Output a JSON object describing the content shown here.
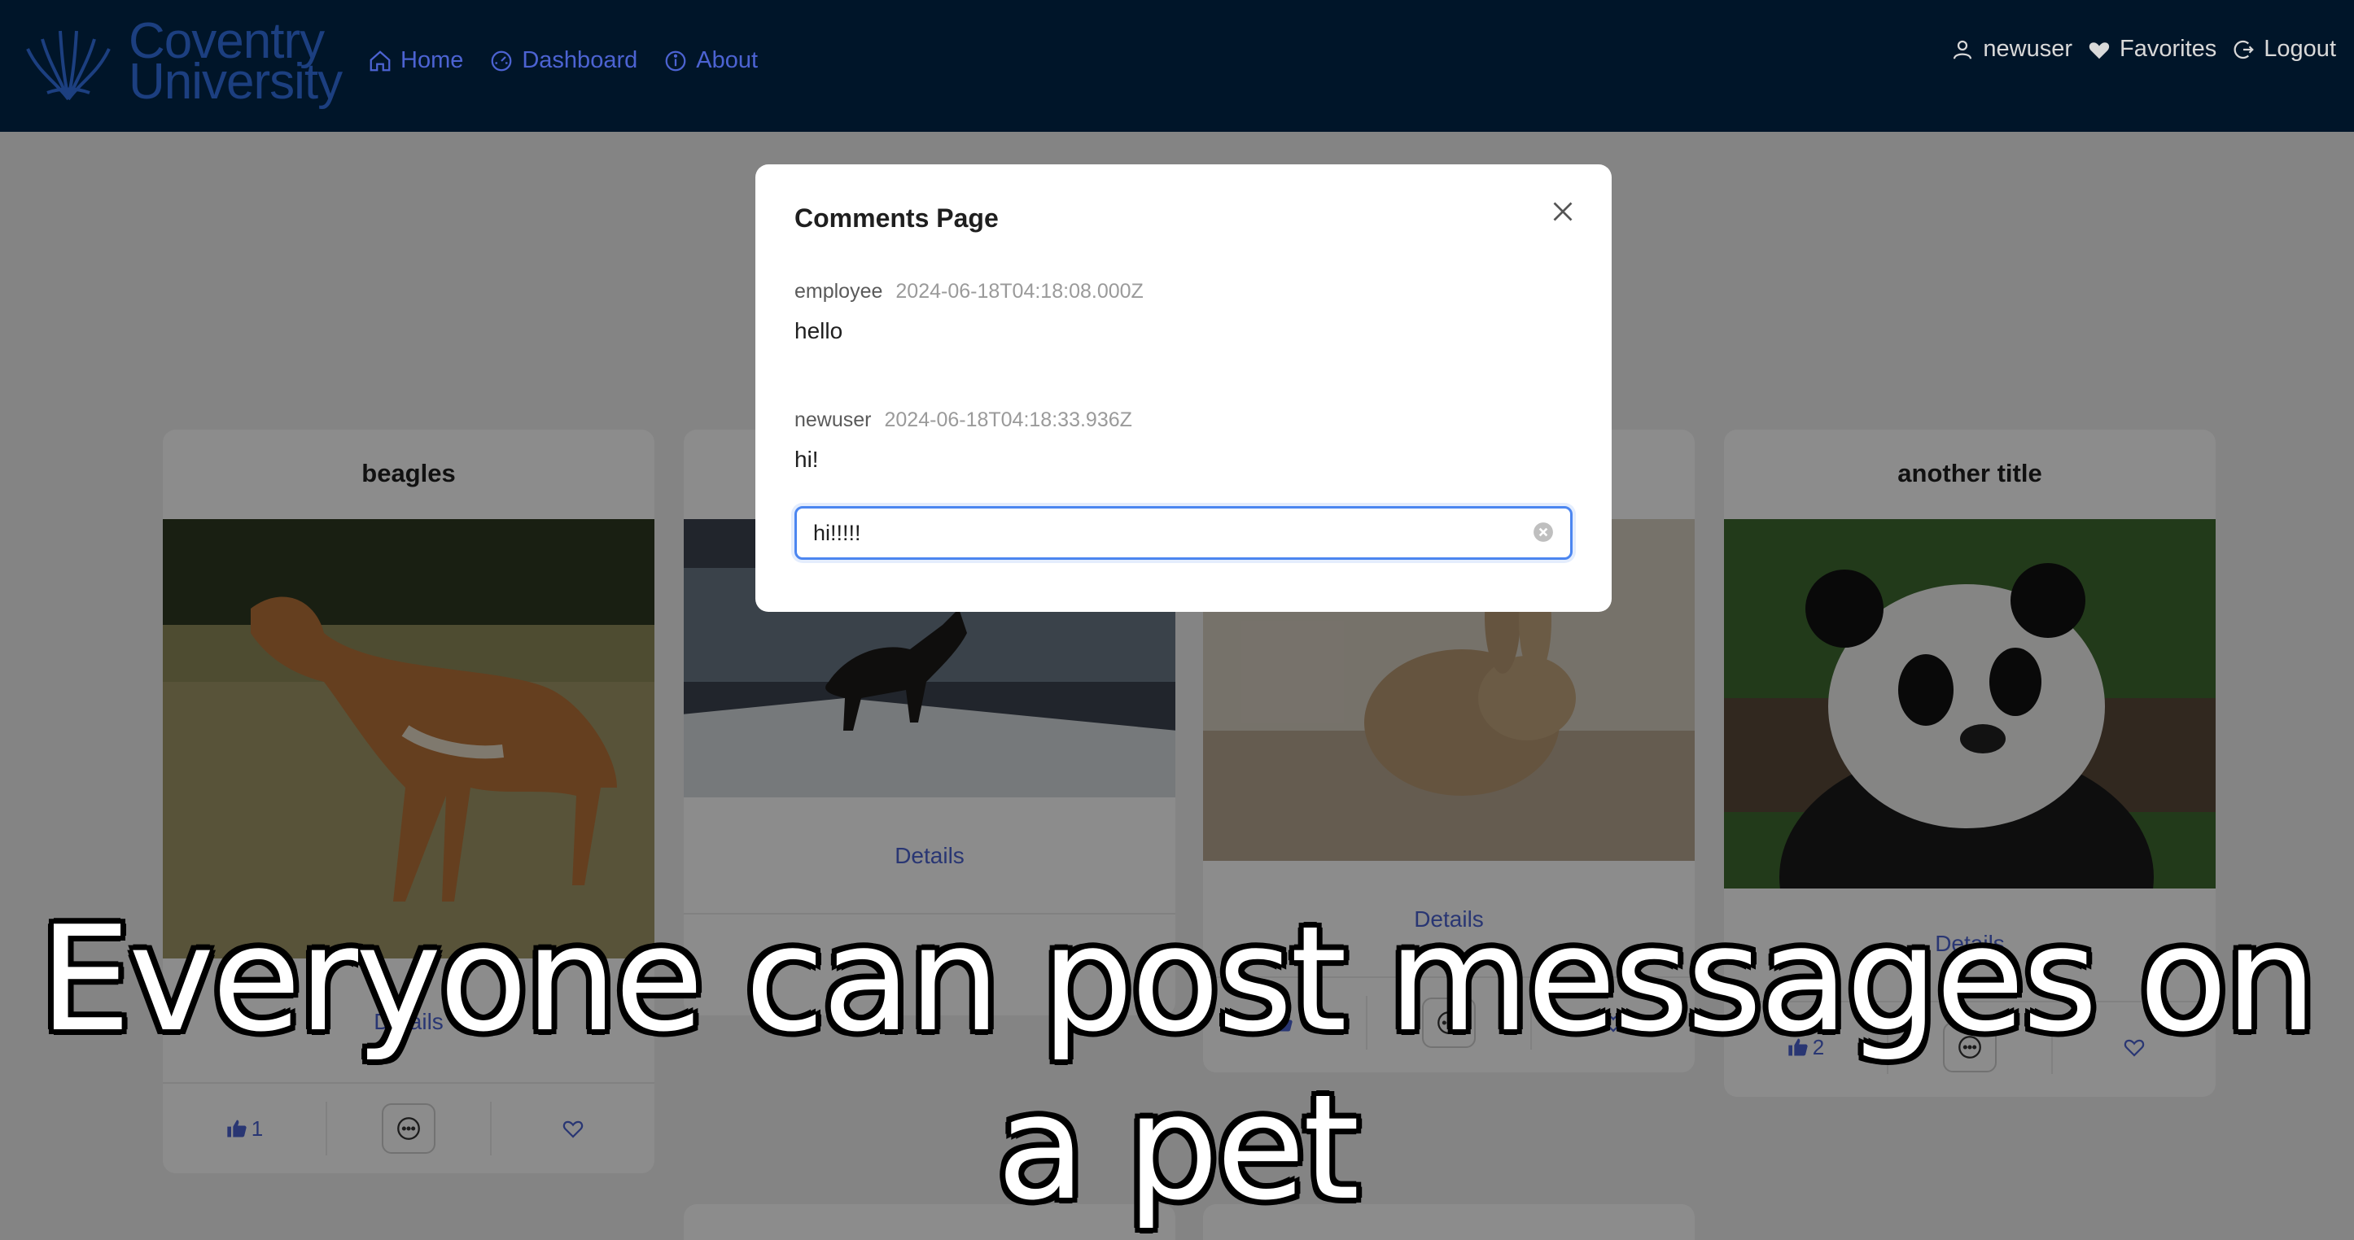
{
  "nav": {
    "logo_text_1": "Coventry",
    "logo_text_2": "University",
    "left": [
      {
        "label": "Home",
        "icon": "home-icon"
      },
      {
        "label": "Dashboard",
        "icon": "dashboard-icon"
      },
      {
        "label": "About",
        "icon": "info-icon"
      }
    ],
    "right": [
      {
        "label": "newuser",
        "icon": "user-icon"
      },
      {
        "label": "Favorites",
        "icon": "heart-icon"
      },
      {
        "label": "Logout",
        "icon": "logout-icon"
      }
    ]
  },
  "cards": [
    {
      "title": "beagles",
      "details": "Details",
      "likes": "1"
    },
    {
      "title": "",
      "details": "Details",
      "likes": ""
    },
    {
      "title": "",
      "details": "Details",
      "likes": ""
    },
    {
      "title": "another title",
      "details": "Details",
      "likes": "2"
    }
  ],
  "modal": {
    "title": "Comments Page",
    "comments": [
      {
        "author": "employee",
        "time": "2024-06-18T04:18:08.000Z",
        "text": "hello"
      },
      {
        "author": "newuser",
        "time": "2024-06-18T04:18:33.936Z",
        "text": "hi!"
      }
    ],
    "input_value": "hi!!!!!"
  },
  "caption": "Everyone can post messages on a pet",
  "colors": {
    "nav_bg": "#001529",
    "accent": "#4c63d2",
    "focus": "#4c86f0"
  }
}
